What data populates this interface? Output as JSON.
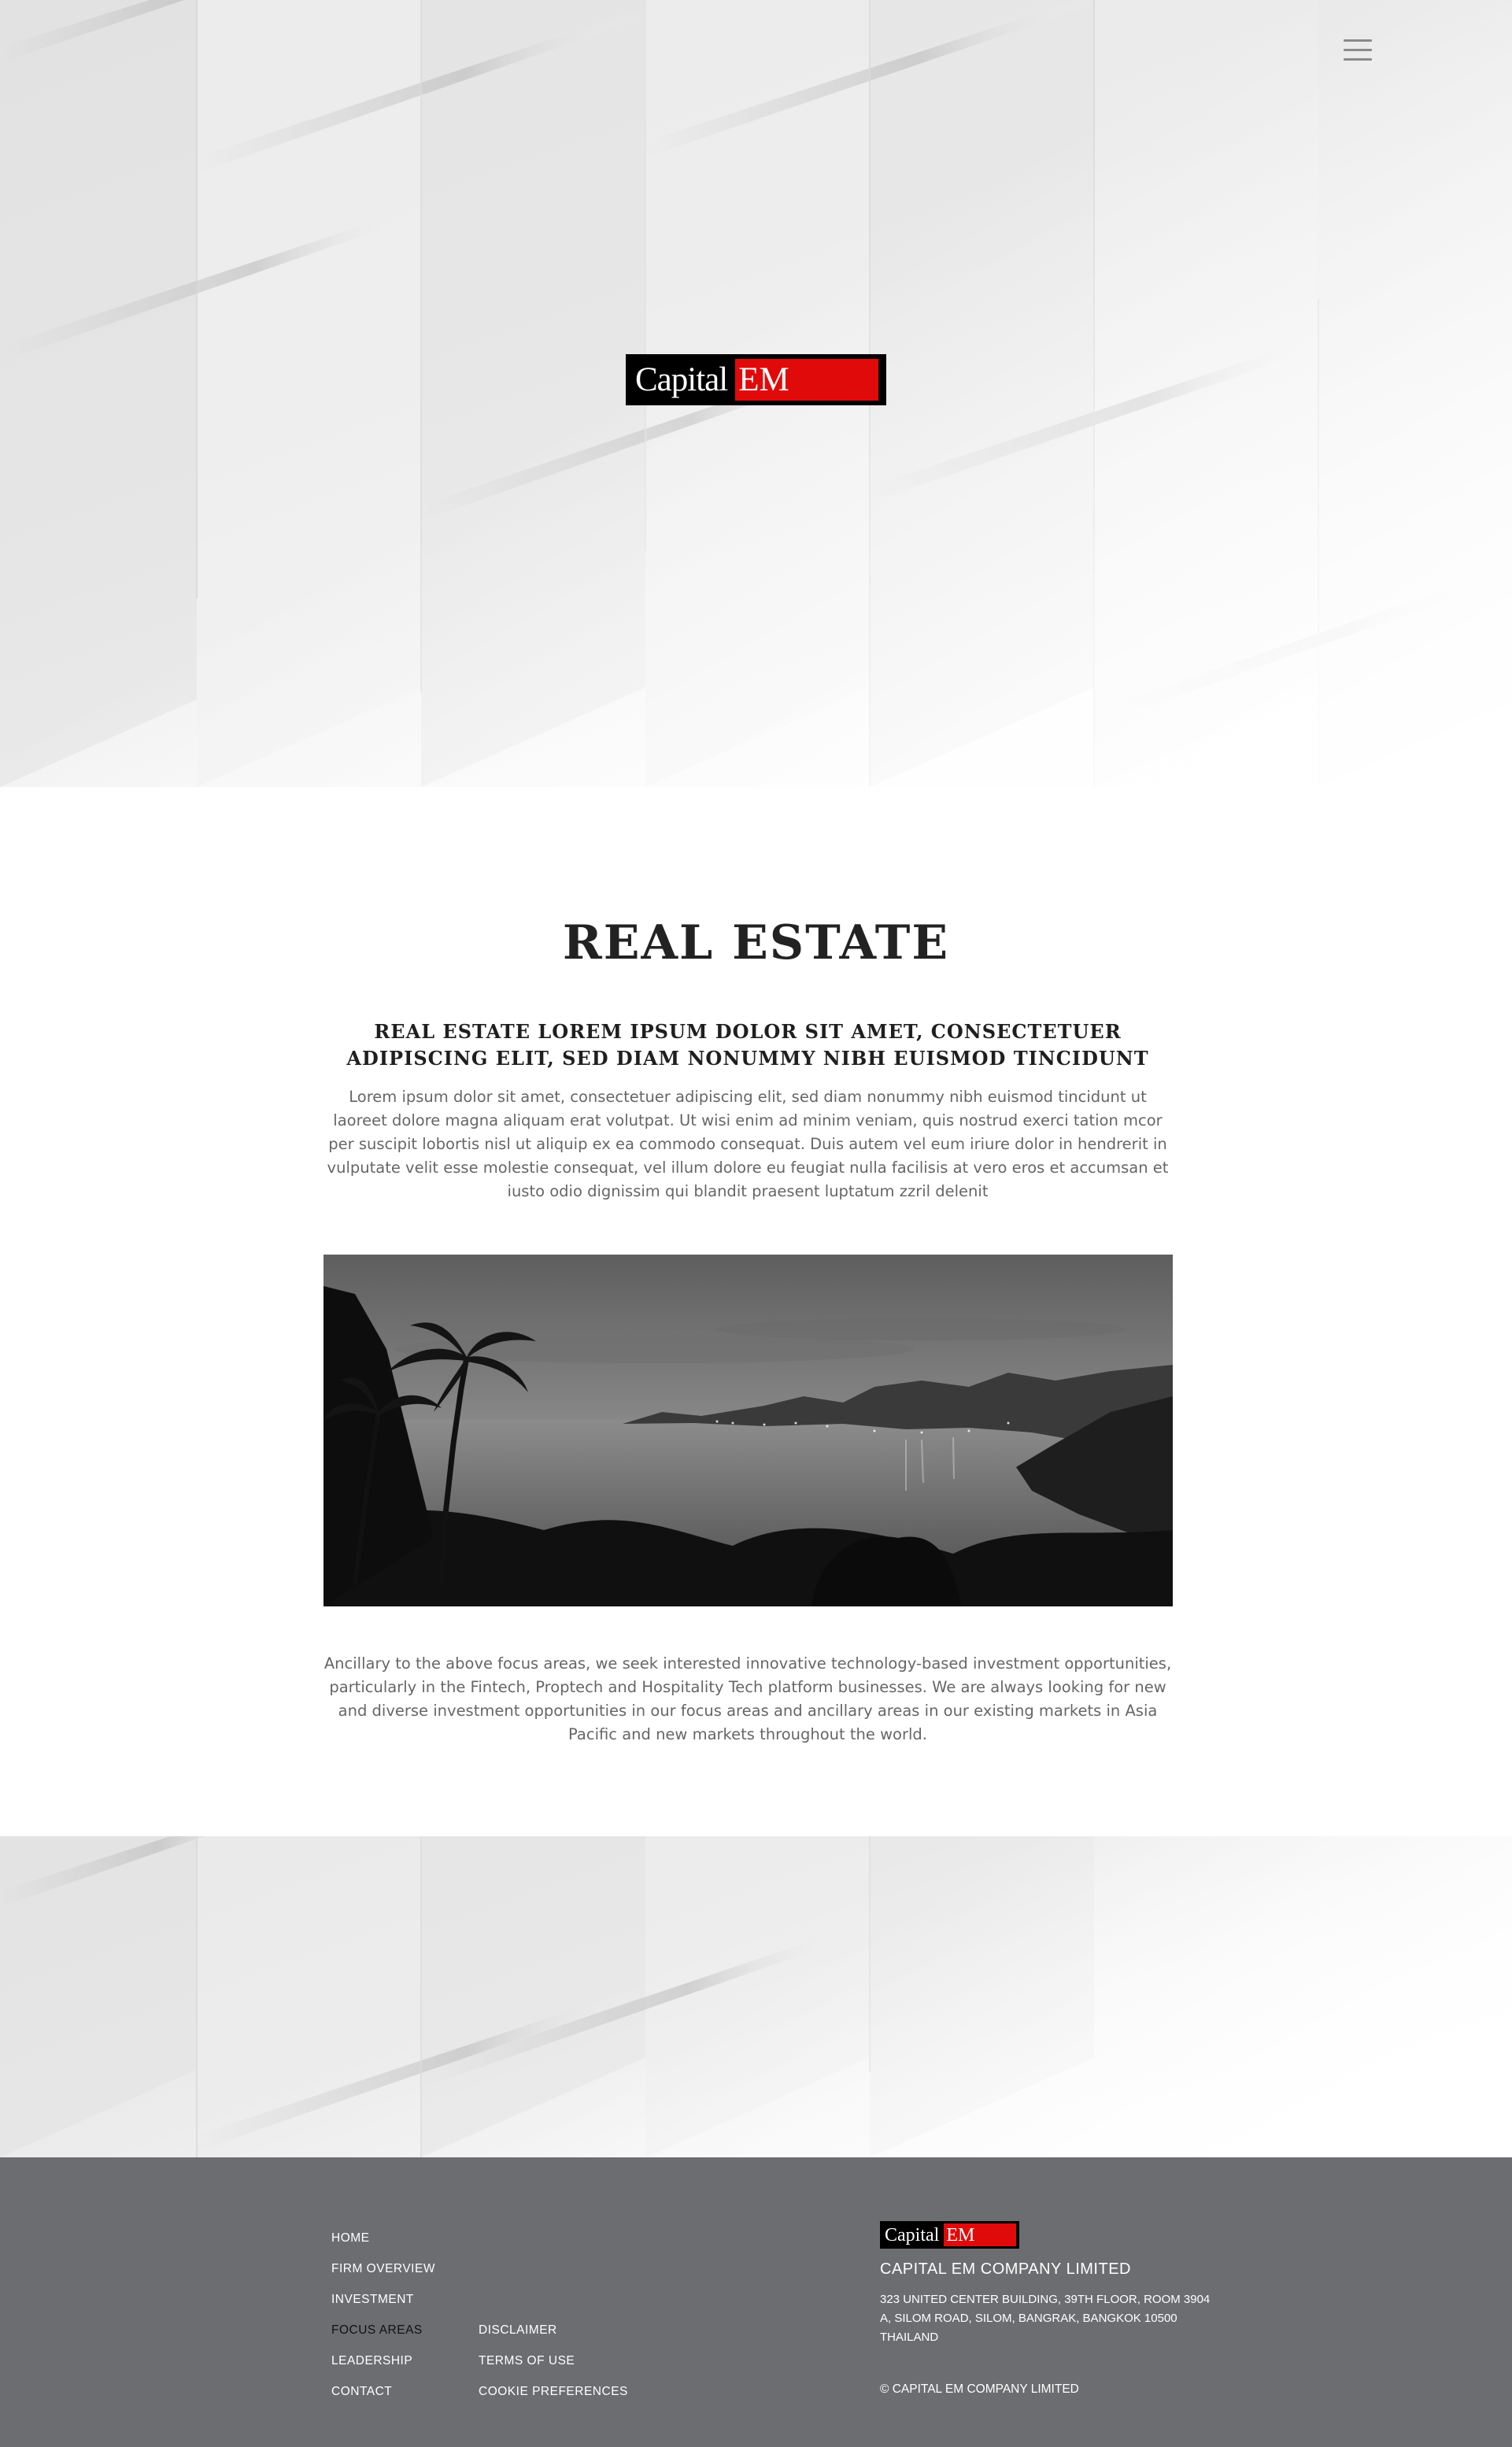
{
  "brand": {
    "logo_word": "Capital",
    "logo_mark": "EM",
    "colors": {
      "logo_background": "#000000",
      "logo_accent": "#e10a0a",
      "footer_background": "#6c6d71"
    }
  },
  "header": {
    "menu_icon": "hamburger-icon"
  },
  "main": {
    "title": "REAL ESTATE",
    "subtitle": "REAL ESTATE LOREM IPSUM DOLOR SIT AMET, CONSECTETUER ADIPISCING ELIT, SED DIAM NONUMMY NIBH EUISMOD TINCIDUNT",
    "intro": "Lorem ipsum dolor sit amet, consectetuer adipiscing elit, sed diam nonummy nibh euismod tincidunt ut laoreet dolore magna aliquam erat volutpat. Ut wisi enim ad minim veniam, quis nostrud exerci tation mcor per suscipit lobortis nisl ut aliquip ex ea commodo consequat. Duis autem vel eum iriure dolor in hendrerit in vulputate velit esse molestie consequat, vel illum dolore eu feugiat nulla facilisis at vero eros et accumsan et iusto odio dignissim qui blandit praesent luptatum zzril delenit",
    "body": "Ancillary to the above focus areas, we seek interested innovative technology-based investment opportunities, particularly in the Fintech, Proptech and Hospitality Tech platform businesses. We are always looking for new and diverse investment opportunities in our focus areas and ancillary areas in our existing markets in Asia Pacific and new markets throughout the world."
  },
  "footer": {
    "nav_primary": [
      "HOME",
      "FIRM OVERVIEW",
      "INVESTMENT",
      "FOCUS AREAS",
      "LEADERSHIP",
      "CONTACT"
    ],
    "nav_secondary": [
      "DISCLAIMER",
      "TERMS OF USE",
      "COOKIE PREFERENCES"
    ],
    "active_item": "FOCUS AREAS",
    "company_name": "CAPITAL EM COMPANY LIMITED",
    "address": "323 UNITED CENTER BUILDING, 39TH FLOOR, ROOM 3904 A, SILOM ROAD, SILOM, BANGRAK, BANGKOK 10500 THAILAND",
    "copyright": "© CAPITAL EM COMPANY LIMITED"
  }
}
